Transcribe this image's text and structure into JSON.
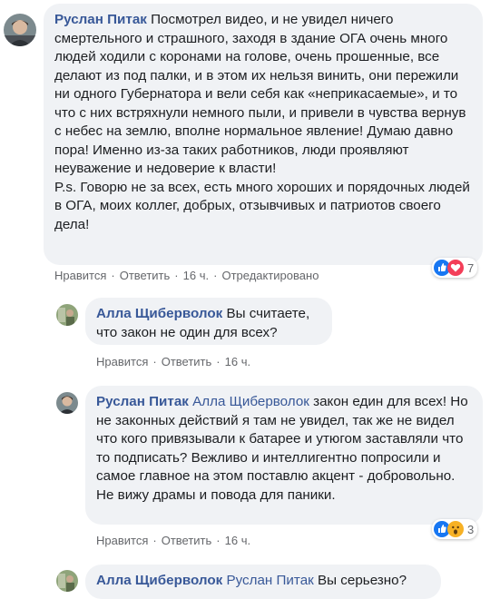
{
  "comments": [
    {
      "author": "Руслан Питак",
      "text": "Посмотрел видео, и не увидел ничего смертельного и страшного, заходя в здание ОГА очень много людей ходили с коронами на голове, очень прошенные, все делают из под палки, и в этом их нельзя винить, они пережили ни одного Губернатора и вели себя как «неприкасаемые», и то что с них встряхнули немного пыли, и привели в чувства вернув с небес на землю, вполне нормальное явление! Думаю давно пора! Именно из-за таких работников, люди проявляют неуважение и недоверие к власти!",
      "ps": "P.s. Говорю не за всех, есть много хороших и порядочных людей в ОГА, моих коллег, добрых, отзывчивых и патриотов своего дела!",
      "like": "Нравится",
      "reply": "Ответить",
      "time": "16 ч.",
      "edited": "Отредактировано",
      "reaction_count": "7"
    },
    {
      "author": "Алла Щиберволок",
      "text": "Вы считаете, что закон не один для всех?",
      "like": "Нравится",
      "reply": "Ответить",
      "time": "16 ч."
    },
    {
      "author": "Руслан Питак",
      "mention": "Алла Щиберволок",
      "text": "закон един для всех! Но не законных действий я там не увидел, так же не видел что кого привязывали к батарее и утюгом заставляли что то подписать? Вежливо и интеллигентно попросили и самое главное на этом поставлю акцент - добровольно. Не вижу драмы и повода для паники.",
      "like": "Нравится",
      "reply": "Ответить",
      "time": "16 ч.",
      "reaction_count": "3"
    },
    {
      "author": "Алла Щиберволок",
      "mention": "Руслан Питак",
      "text": "Вы серьезно?"
    }
  ],
  "colors": {
    "link": "#385898",
    "bubble": "#f0f2f5",
    "meta": "#65676b",
    "like": "#1877f2",
    "love": "#f33e58",
    "wow": "#f7b125"
  },
  "icons": {
    "like": "like-reaction-icon",
    "love": "love-reaction-icon",
    "wow": "wow-reaction-icon"
  }
}
